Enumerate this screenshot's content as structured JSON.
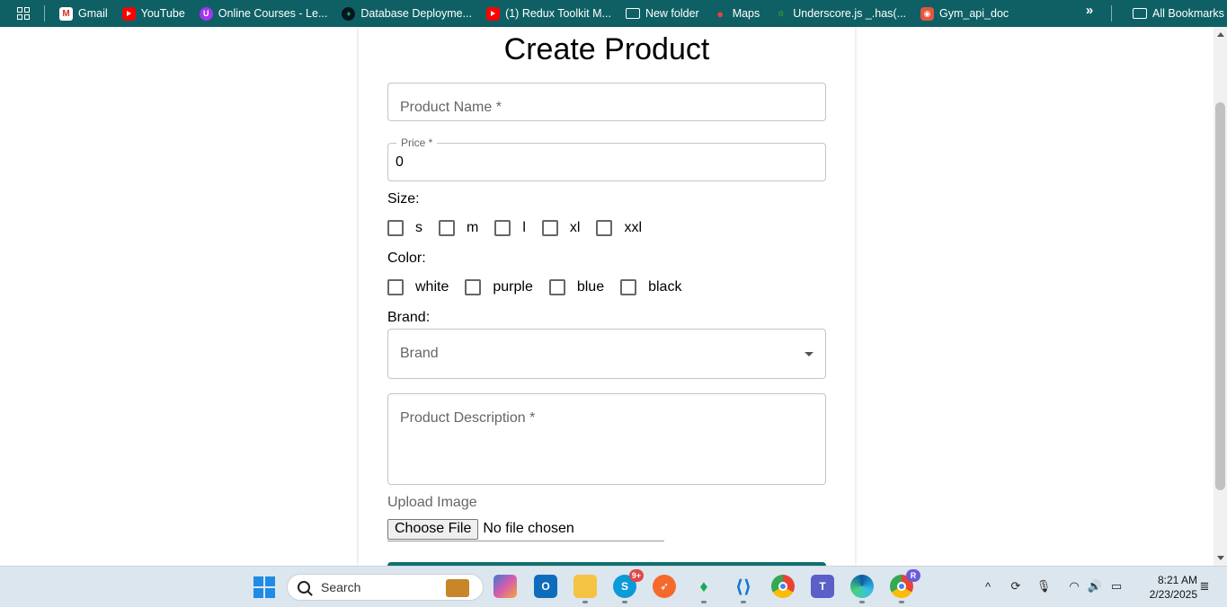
{
  "bookmarks": {
    "items": [
      {
        "label": "Gmail",
        "icon": "gmail-icon"
      },
      {
        "label": "YouTube",
        "icon": "youtube-icon"
      },
      {
        "label": "Online Courses - Le...",
        "icon": "udemy-icon"
      },
      {
        "label": "Database Deployme...",
        "icon": "mongodb-icon"
      },
      {
        "label": "(1) Redux Toolkit M...",
        "icon": "youtube-icon"
      },
      {
        "label": "New folder",
        "icon": "folder-icon"
      },
      {
        "label": "Maps",
        "icon": "maps-icon"
      },
      {
        "label": "Underscore.js _.has(...",
        "icon": "gfg-icon"
      },
      {
        "label": "Gym_api_doc",
        "icon": "postman-icon"
      }
    ],
    "more": "»",
    "all_bookmarks": "All Bookmarks"
  },
  "form": {
    "title": "Create Product",
    "product_name_placeholder": "Product Name *",
    "price_label": "Price *",
    "price_value": "0",
    "size_label": "Size:",
    "sizes": [
      "s",
      "m",
      "l",
      "xl",
      "xxl"
    ],
    "color_label": "Color:",
    "colors": [
      "white",
      "purple",
      "blue",
      "black"
    ],
    "brand_label": "Brand:",
    "brand_placeholder": "Brand",
    "description_placeholder": "Product Description *",
    "upload_label": "Upload Image",
    "choose_file": "Choose File",
    "no_file": "No file chosen"
  },
  "taskbar": {
    "search_placeholder": "Search",
    "skype_badge": "9+",
    "chrome_profile_badge": "R",
    "time": "8:21 AM",
    "date": "2/23/2025"
  },
  "colors": {
    "bookmarks_bar": "#0f6064",
    "submit_button": "#107070",
    "taskbar": "#dce6ee"
  }
}
